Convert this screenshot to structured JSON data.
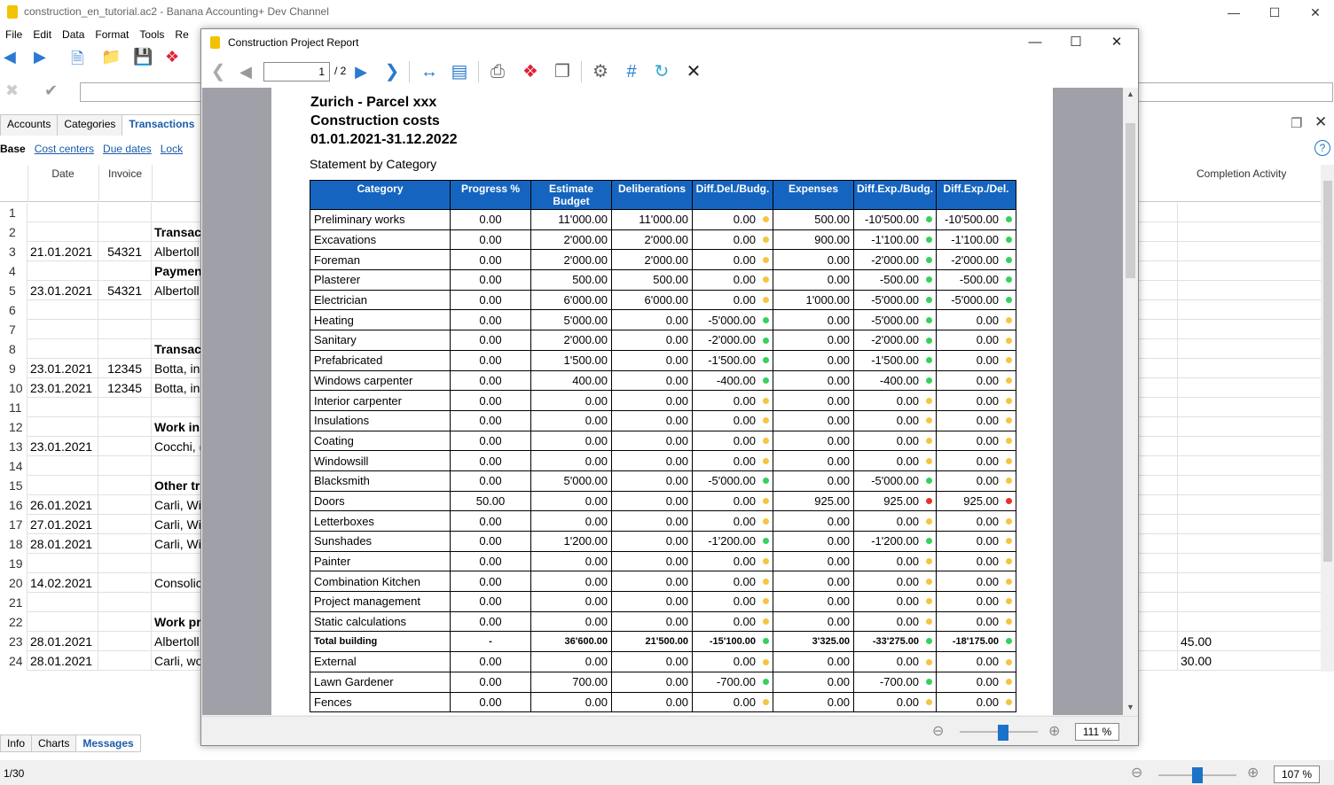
{
  "window": {
    "title": "construction_en_tutorial.ac2 - Banana Accounting+ Dev Channel"
  },
  "menu": [
    "File",
    "Edit",
    "Data",
    "Format",
    "Tools",
    "Re"
  ],
  "tabs": [
    "Accounts",
    "Categories",
    "Transactions"
  ],
  "active_tab": "Transactions",
  "views": [
    "Base",
    "Cost centers",
    "Due dates",
    "Lock"
  ],
  "grid": {
    "headers": {
      "date": "Date",
      "invoice": "Invoice"
    },
    "rows": [
      {
        "n": "1",
        "date": "",
        "inv": "",
        "desc": "",
        "bold": false
      },
      {
        "n": "2",
        "date": "",
        "inv": "",
        "desc": "Transac",
        "bold": true
      },
      {
        "n": "3",
        "date": "21.01.2021",
        "inv": "54321",
        "desc": "Albertoll",
        "bold": false
      },
      {
        "n": "4",
        "date": "",
        "inv": "",
        "desc": "Paymen",
        "bold": true
      },
      {
        "n": "5",
        "date": "23.01.2021",
        "inv": "54321",
        "desc": "Albertoll",
        "bold": false
      },
      {
        "n": "6",
        "date": "",
        "inv": "",
        "desc": "",
        "bold": false
      },
      {
        "n": "7",
        "date": "",
        "inv": "",
        "desc": "",
        "bold": false
      },
      {
        "n": "8",
        "date": "",
        "inv": "",
        "desc": "Transac",
        "bold": true
      },
      {
        "n": "9",
        "date": "23.01.2021",
        "inv": "12345",
        "desc": "Botta, in",
        "bold": false
      },
      {
        "n": "10",
        "date": "23.01.2021",
        "inv": "12345",
        "desc": "Botta, in",
        "bold": false
      },
      {
        "n": "11",
        "date": "",
        "inv": "",
        "desc": "",
        "bold": false
      },
      {
        "n": "12",
        "date": "",
        "inv": "",
        "desc": "Work in",
        "bold": true
      },
      {
        "n": "13",
        "date": "23.01.2021",
        "inv": "",
        "desc": "Cocchi, (",
        "bold": false
      },
      {
        "n": "14",
        "date": "",
        "inv": "",
        "desc": "",
        "bold": false
      },
      {
        "n": "15",
        "date": "",
        "inv": "",
        "desc": "Other tr",
        "bold": true
      },
      {
        "n": "16",
        "date": "26.01.2021",
        "inv": "",
        "desc": "Carli, Wi",
        "bold": false
      },
      {
        "n": "17",
        "date": "27.01.2021",
        "inv": "",
        "desc": "Carli, Wi",
        "bold": false
      },
      {
        "n": "18",
        "date": "28.01.2021",
        "inv": "",
        "desc": "Carli, Wi",
        "bold": false
      },
      {
        "n": "19",
        "date": "",
        "inv": "",
        "desc": "",
        "bold": false
      },
      {
        "n": "20",
        "date": "14.02.2021",
        "inv": "",
        "desc": "Consolic",
        "bold": false
      },
      {
        "n": "21",
        "date": "",
        "inv": "",
        "desc": "",
        "bold": false
      },
      {
        "n": "22",
        "date": "",
        "inv": "",
        "desc": "Work pr",
        "bold": true
      },
      {
        "n": "23",
        "date": "28.01.2021",
        "inv": "",
        "desc": "Albertoll",
        "bold": false
      },
      {
        "n": "24",
        "date": "28.01.2021",
        "inv": "",
        "desc": "Carli, wo",
        "bold": false
      }
    ],
    "right_column": {
      "header": "Completion Activity",
      "values": {
        "23": "45.00",
        "24": "30.00"
      }
    }
  },
  "bottom_tabs": [
    "Info",
    "Charts",
    "Messages"
  ],
  "status": {
    "position": "1/30",
    "zoom": "107 %"
  },
  "dialog": {
    "title": "Construction Project Report",
    "page_current": "1",
    "page_total": "/ 2",
    "zoom": "111 %",
    "report": {
      "title_lines": [
        "Zurich - Parcel xxx",
        "Construction costs",
        "01.01.2021-31.12.2022"
      ],
      "subtitle": "Statement by Category",
      "columns": [
        "Category",
        "Progress %",
        "Estimate Budget",
        "Deliberations",
        "Diff.Del./Budg.",
        "Expenses",
        "Diff.Exp./Budg.",
        "Diff.Exp./Del."
      ],
      "rows": [
        [
          "Preliminary works",
          "0.00",
          "11'000.00",
          "11'000.00",
          "0.00",
          "yellow",
          "500.00",
          "-10'500.00",
          "green",
          "-10'500.00",
          "green"
        ],
        [
          "Excavations",
          "0.00",
          "2'000.00",
          "2'000.00",
          "0.00",
          "yellow",
          "900.00",
          "-1'100.00",
          "green",
          "-1'100.00",
          "green"
        ],
        [
          "Foreman",
          "0.00",
          "2'000.00",
          "2'000.00",
          "0.00",
          "yellow",
          "0.00",
          "-2'000.00",
          "green",
          "-2'000.00",
          "green"
        ],
        [
          "Plasterer",
          "0.00",
          "500.00",
          "500.00",
          "0.00",
          "yellow",
          "0.00",
          "-500.00",
          "green",
          "-500.00",
          "green"
        ],
        [
          "Electrician",
          "0.00",
          "6'000.00",
          "6'000.00",
          "0.00",
          "yellow",
          "1'000.00",
          "-5'000.00",
          "green",
          "-5'000.00",
          "green"
        ],
        [
          "Heating",
          "0.00",
          "5'000.00",
          "0.00",
          "-5'000.00",
          "green",
          "0.00",
          "-5'000.00",
          "green",
          "0.00",
          "yellow"
        ],
        [
          "Sanitary",
          "0.00",
          "2'000.00",
          "0.00",
          "-2'000.00",
          "green",
          "0.00",
          "-2'000.00",
          "green",
          "0.00",
          "yellow"
        ],
        [
          "Prefabricated",
          "0.00",
          "1'500.00",
          "0.00",
          "-1'500.00",
          "green",
          "0.00",
          "-1'500.00",
          "green",
          "0.00",
          "yellow"
        ],
        [
          "Windows carpenter",
          "0.00",
          "400.00",
          "0.00",
          "-400.00",
          "green",
          "0.00",
          "-400.00",
          "green",
          "0.00",
          "yellow"
        ],
        [
          "Interior carpenter",
          "0.00",
          "0.00",
          "0.00",
          "0.00",
          "yellow",
          "0.00",
          "0.00",
          "yellow",
          "0.00",
          "yellow"
        ],
        [
          "Insulations",
          "0.00",
          "0.00",
          "0.00",
          "0.00",
          "yellow",
          "0.00",
          "0.00",
          "yellow",
          "0.00",
          "yellow"
        ],
        [
          "Coating",
          "0.00",
          "0.00",
          "0.00",
          "0.00",
          "yellow",
          "0.00",
          "0.00",
          "yellow",
          "0.00",
          "yellow"
        ],
        [
          "Windowsill",
          "0.00",
          "0.00",
          "0.00",
          "0.00",
          "yellow",
          "0.00",
          "0.00",
          "yellow",
          "0.00",
          "yellow"
        ],
        [
          "Blacksmith",
          "0.00",
          "5'000.00",
          "0.00",
          "-5'000.00",
          "green",
          "0.00",
          "-5'000.00",
          "green",
          "0.00",
          "yellow"
        ],
        [
          "Doors",
          "50.00",
          "0.00",
          "0.00",
          "0.00",
          "yellow",
          "925.00",
          "925.00",
          "red",
          "925.00",
          "red"
        ],
        [
          "Letterboxes",
          "0.00",
          "0.00",
          "0.00",
          "0.00",
          "yellow",
          "0.00",
          "0.00",
          "yellow",
          "0.00",
          "yellow"
        ],
        [
          "Sunshades",
          "0.00",
          "1'200.00",
          "0.00",
          "-1'200.00",
          "green",
          "0.00",
          "-1'200.00",
          "green",
          "0.00",
          "yellow"
        ],
        [
          "Painter",
          "0.00",
          "0.00",
          "0.00",
          "0.00",
          "yellow",
          "0.00",
          "0.00",
          "yellow",
          "0.00",
          "yellow"
        ],
        [
          "Combination Kitchen",
          "0.00",
          "0.00",
          "0.00",
          "0.00",
          "yellow",
          "0.00",
          "0.00",
          "yellow",
          "0.00",
          "yellow"
        ],
        [
          "Project management",
          "0.00",
          "0.00",
          "0.00",
          "0.00",
          "yellow",
          "0.00",
          "0.00",
          "yellow",
          "0.00",
          "yellow"
        ],
        [
          "Static calculations",
          "0.00",
          "0.00",
          "0.00",
          "0.00",
          "yellow",
          "0.00",
          "0.00",
          "yellow",
          "0.00",
          "yellow"
        ],
        [
          "Total building",
          "-",
          "36'600.00",
          "21'500.00",
          "-15'100.00",
          "green",
          "3'325.00",
          "-33'275.00",
          "green",
          "-18'175.00",
          "green"
        ],
        [
          "External",
          "0.00",
          "0.00",
          "0.00",
          "0.00",
          "yellow",
          "0.00",
          "0.00",
          "yellow",
          "0.00",
          "yellow"
        ],
        [
          "Lawn Gardener",
          "0.00",
          "700.00",
          "0.00",
          "-700.00",
          "green",
          "0.00",
          "-700.00",
          "green",
          "0.00",
          "yellow"
        ],
        [
          "Fences",
          "0.00",
          "0.00",
          "0.00",
          "0.00",
          "yellow",
          "0.00",
          "0.00",
          "yellow",
          "0.00",
          "yellow"
        ]
      ]
    }
  },
  "colors": {
    "header_blue": "#1565c0",
    "dot_yellow": "#f5c542",
    "dot_green": "#37d05a",
    "dot_red": "#e8312b",
    "accent": "#1a5ba8"
  }
}
